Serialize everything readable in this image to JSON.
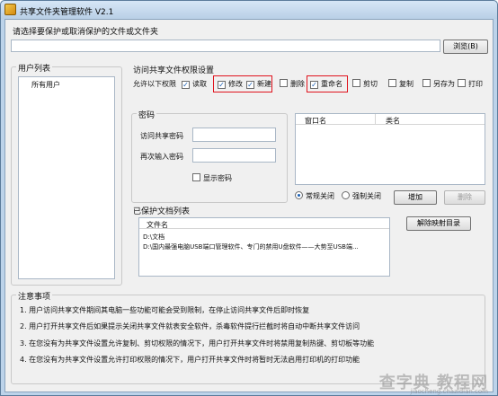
{
  "window": {
    "title": "共享文件夹管理软件 V2.1"
  },
  "prompt_label": "请选择要保护或取消保护的文件或文件夹",
  "browse_button": "浏览(B)",
  "user_list": {
    "group_label": "用户列表",
    "items": [
      "所有用户"
    ]
  },
  "permissions": {
    "group_label": "访问共享文件权限设置",
    "allow_label": "允许以下权限",
    "items": [
      {
        "label": "读取",
        "checked": true
      },
      {
        "label": "修改",
        "checked": true
      },
      {
        "label": "新建",
        "checked": true
      },
      {
        "label": "删除",
        "checked": false
      },
      {
        "label": "重命名",
        "checked": true
      },
      {
        "label": "剪切",
        "checked": false
      },
      {
        "label": "复制",
        "checked": false
      },
      {
        "label": "另存为",
        "checked": false
      },
      {
        "label": "打印",
        "checked": false
      }
    ]
  },
  "password": {
    "group_label": "密码",
    "access_label": "访问共享密码",
    "confirm_label": "再次输入密码",
    "show_label": "显示密码"
  },
  "window_list": {
    "col_window": "窗口名",
    "col_class": "类名",
    "radio_normal": "常规关闭",
    "radio_force": "强制关闭",
    "add_button": "增加",
    "delete_button": "删除"
  },
  "protected_list": {
    "group_label": "已保护文档列表",
    "header": "文件名",
    "rows": [
      "D:\\文档",
      "D:\\国内最强电脑USB端口管理软件、专门的禁用U盘软件——大势至USB端..."
    ],
    "remove_button": "解除映射目录"
  },
  "notes": {
    "group_label": "注意事项",
    "lines": [
      "1. 用户访问共享文件期间其电脑一些功能可能会受到限制，在停止访问共享文件后即时恢复",
      "2. 用户打开共享文件后如果提示关闭共享文件就表安全软件，杀毒软件提行拦截时将自动中断共享文件访问",
      "3. 在您没有为共享文件设置允许复制、剪切权限的情况下，用户打开共享文件时将禁用复制热键、剪切板等功能",
      "4. 在您没有为共享文件设置允许打印权限的情况下，用户打开共享文件时将暂时无法启用打印机的打印功能"
    ]
  },
  "watermark": {
    "main": "查字典 教程网",
    "sub": "jiaocheng.chazidian.com"
  }
}
